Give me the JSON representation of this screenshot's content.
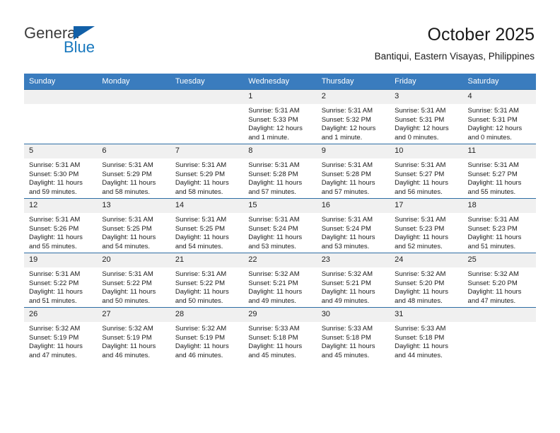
{
  "brand": {
    "name_part1": "General",
    "name_part2": "Blue",
    "flag_icon": "blue-triangle-flag-icon"
  },
  "header": {
    "title": "October 2025",
    "subtitle": "Bantiqui, Eastern Visayas, Philippines"
  },
  "calendar": {
    "weekday_headers": [
      "Sunday",
      "Monday",
      "Tuesday",
      "Wednesday",
      "Thursday",
      "Friday",
      "Saturday"
    ],
    "header_bg": "#3a7cbe",
    "row_border": "#2e6da4",
    "daynum_bg": "#f0f0f0",
    "weeks": [
      [
        {
          "day": "",
          "lines": []
        },
        {
          "day": "",
          "lines": []
        },
        {
          "day": "",
          "lines": []
        },
        {
          "day": "1",
          "lines": [
            "Sunrise: 5:31 AM",
            "Sunset: 5:33 PM",
            "Daylight: 12 hours",
            "and 1 minute."
          ]
        },
        {
          "day": "2",
          "lines": [
            "Sunrise: 5:31 AM",
            "Sunset: 5:32 PM",
            "Daylight: 12 hours",
            "and 1 minute."
          ]
        },
        {
          "day": "3",
          "lines": [
            "Sunrise: 5:31 AM",
            "Sunset: 5:31 PM",
            "Daylight: 12 hours",
            "and 0 minutes."
          ]
        },
        {
          "day": "4",
          "lines": [
            "Sunrise: 5:31 AM",
            "Sunset: 5:31 PM",
            "Daylight: 12 hours",
            "and 0 minutes."
          ]
        }
      ],
      [
        {
          "day": "5",
          "lines": [
            "Sunrise: 5:31 AM",
            "Sunset: 5:30 PM",
            "Daylight: 11 hours",
            "and 59 minutes."
          ]
        },
        {
          "day": "6",
          "lines": [
            "Sunrise: 5:31 AM",
            "Sunset: 5:29 PM",
            "Daylight: 11 hours",
            "and 58 minutes."
          ]
        },
        {
          "day": "7",
          "lines": [
            "Sunrise: 5:31 AM",
            "Sunset: 5:29 PM",
            "Daylight: 11 hours",
            "and 58 minutes."
          ]
        },
        {
          "day": "8",
          "lines": [
            "Sunrise: 5:31 AM",
            "Sunset: 5:28 PM",
            "Daylight: 11 hours",
            "and 57 minutes."
          ]
        },
        {
          "day": "9",
          "lines": [
            "Sunrise: 5:31 AM",
            "Sunset: 5:28 PM",
            "Daylight: 11 hours",
            "and 57 minutes."
          ]
        },
        {
          "day": "10",
          "lines": [
            "Sunrise: 5:31 AM",
            "Sunset: 5:27 PM",
            "Daylight: 11 hours",
            "and 56 minutes."
          ]
        },
        {
          "day": "11",
          "lines": [
            "Sunrise: 5:31 AM",
            "Sunset: 5:27 PM",
            "Daylight: 11 hours",
            "and 55 minutes."
          ]
        }
      ],
      [
        {
          "day": "12",
          "lines": [
            "Sunrise: 5:31 AM",
            "Sunset: 5:26 PM",
            "Daylight: 11 hours",
            "and 55 minutes."
          ]
        },
        {
          "day": "13",
          "lines": [
            "Sunrise: 5:31 AM",
            "Sunset: 5:25 PM",
            "Daylight: 11 hours",
            "and 54 minutes."
          ]
        },
        {
          "day": "14",
          "lines": [
            "Sunrise: 5:31 AM",
            "Sunset: 5:25 PM",
            "Daylight: 11 hours",
            "and 54 minutes."
          ]
        },
        {
          "day": "15",
          "lines": [
            "Sunrise: 5:31 AM",
            "Sunset: 5:24 PM",
            "Daylight: 11 hours",
            "and 53 minutes."
          ]
        },
        {
          "day": "16",
          "lines": [
            "Sunrise: 5:31 AM",
            "Sunset: 5:24 PM",
            "Daylight: 11 hours",
            "and 53 minutes."
          ]
        },
        {
          "day": "17",
          "lines": [
            "Sunrise: 5:31 AM",
            "Sunset: 5:23 PM",
            "Daylight: 11 hours",
            "and 52 minutes."
          ]
        },
        {
          "day": "18",
          "lines": [
            "Sunrise: 5:31 AM",
            "Sunset: 5:23 PM",
            "Daylight: 11 hours",
            "and 51 minutes."
          ]
        }
      ],
      [
        {
          "day": "19",
          "lines": [
            "Sunrise: 5:31 AM",
            "Sunset: 5:22 PM",
            "Daylight: 11 hours",
            "and 51 minutes."
          ]
        },
        {
          "day": "20",
          "lines": [
            "Sunrise: 5:31 AM",
            "Sunset: 5:22 PM",
            "Daylight: 11 hours",
            "and 50 minutes."
          ]
        },
        {
          "day": "21",
          "lines": [
            "Sunrise: 5:31 AM",
            "Sunset: 5:22 PM",
            "Daylight: 11 hours",
            "and 50 minutes."
          ]
        },
        {
          "day": "22",
          "lines": [
            "Sunrise: 5:32 AM",
            "Sunset: 5:21 PM",
            "Daylight: 11 hours",
            "and 49 minutes."
          ]
        },
        {
          "day": "23",
          "lines": [
            "Sunrise: 5:32 AM",
            "Sunset: 5:21 PM",
            "Daylight: 11 hours",
            "and 49 minutes."
          ]
        },
        {
          "day": "24",
          "lines": [
            "Sunrise: 5:32 AM",
            "Sunset: 5:20 PM",
            "Daylight: 11 hours",
            "and 48 minutes."
          ]
        },
        {
          "day": "25",
          "lines": [
            "Sunrise: 5:32 AM",
            "Sunset: 5:20 PM",
            "Daylight: 11 hours",
            "and 47 minutes."
          ]
        }
      ],
      [
        {
          "day": "26",
          "lines": [
            "Sunrise: 5:32 AM",
            "Sunset: 5:19 PM",
            "Daylight: 11 hours",
            "and 47 minutes."
          ]
        },
        {
          "day": "27",
          "lines": [
            "Sunrise: 5:32 AM",
            "Sunset: 5:19 PM",
            "Daylight: 11 hours",
            "and 46 minutes."
          ]
        },
        {
          "day": "28",
          "lines": [
            "Sunrise: 5:32 AM",
            "Sunset: 5:19 PM",
            "Daylight: 11 hours",
            "and 46 minutes."
          ]
        },
        {
          "day": "29",
          "lines": [
            "Sunrise: 5:33 AM",
            "Sunset: 5:18 PM",
            "Daylight: 11 hours",
            "and 45 minutes."
          ]
        },
        {
          "day": "30",
          "lines": [
            "Sunrise: 5:33 AM",
            "Sunset: 5:18 PM",
            "Daylight: 11 hours",
            "and 45 minutes."
          ]
        },
        {
          "day": "31",
          "lines": [
            "Sunrise: 5:33 AM",
            "Sunset: 5:18 PM",
            "Daylight: 11 hours",
            "and 44 minutes."
          ]
        },
        {
          "day": "",
          "lines": []
        }
      ]
    ]
  }
}
